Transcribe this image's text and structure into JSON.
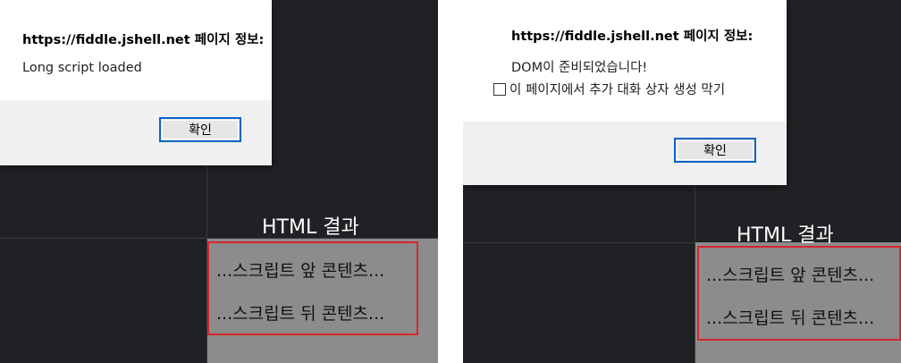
{
  "left": {
    "dialog": {
      "title": "https://fiddle.jshell.net 페이지 정보:",
      "message": "Long script loaded",
      "ok_label": "확인"
    },
    "result": {
      "label": "HTML 결과",
      "line1": "...스크립트 앞 콘텐츠...",
      "line2": "...스크립트 뒤 콘텐츠..."
    }
  },
  "right": {
    "dialog": {
      "title": "https://fiddle.jshell.net 페이지 정보:",
      "message": "DOM이 준비되었습니다!",
      "suppress_label": "이 페이지에서 추가 대화 상자 생성 막기",
      "ok_label": "확인"
    },
    "result": {
      "label": "HTML 결과",
      "line1": "...스크립트 앞 콘텐츠...",
      "line2": "...스크립트 뒤 콘텐츠..."
    }
  },
  "colors": {
    "editor_background": "#202124",
    "result_background": "#8c8c8c",
    "highlight_border": "#d8262b",
    "button_focus_border": "#0a64c8"
  }
}
